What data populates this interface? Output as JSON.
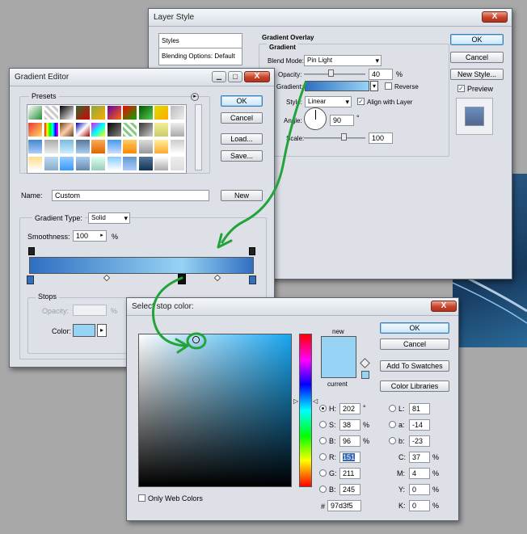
{
  "layer_style": {
    "title": "Layer Style",
    "sidebar": [
      "Styles",
      "Blending Options: Default"
    ],
    "section_title": "Gradient Overlay",
    "group_title": "Gradient",
    "blend_mode_label": "Blend Mode:",
    "blend_mode": "Pin Light",
    "opacity_label": "Opacity:",
    "opacity": "40",
    "opacity_unit": "%",
    "gradient_label": "Gradient:",
    "reverse_label": "Reverse",
    "style_label": "Style:",
    "style": "Linear",
    "align_label": "Align with Layer",
    "angle_label": "Angle:",
    "angle": "90",
    "angle_unit": "°",
    "scale_label": "Scale:",
    "scale": "100",
    "ok": "OK",
    "cancel": "Cancel",
    "new_style": "New Style...",
    "preview_label": "Preview",
    "close_glyph": "X"
  },
  "gradient_editor": {
    "title": "Gradient Editor",
    "presets_label": "Presets",
    "ok": "OK",
    "cancel": "Cancel",
    "load": "Load...",
    "save": "Save...",
    "name_label": "Name:",
    "name_value": "Custom",
    "new": "New",
    "gradient_type_label": "Gradient Type:",
    "gradient_type": "Solid",
    "smoothness_label": "Smoothness:",
    "smoothness": "100",
    "smoothness_unit": "%",
    "stops_label": "Stops",
    "opacity_label": "Opacity:",
    "opacity_unit": "%",
    "color_label": "Color:",
    "close_glyph": "X",
    "gradient_from": "#2f6fc0",
    "gradient_to": "#97d3f5"
  },
  "color_picker": {
    "title": "Select stop color:",
    "ok": "OK",
    "cancel": "Cancel",
    "add_swatches": "Add To Swatches",
    "color_libraries": "Color Libraries",
    "new_label": "new",
    "current_label": "current",
    "only_web": "Only Web Colors",
    "close_glyph": "X",
    "current_color": "#97d3f5",
    "hsb": [
      {
        "label": "H:",
        "value": "202",
        "unit": "°"
      },
      {
        "label": "S:",
        "value": "38",
        "unit": "%"
      },
      {
        "label": "B:",
        "value": "96",
        "unit": "%"
      }
    ],
    "rgb": [
      {
        "label": "R:",
        "value": "151"
      },
      {
        "label": "G:",
        "value": "211"
      },
      {
        "label": "B:",
        "value": "245"
      }
    ],
    "lab": [
      {
        "label": "L:",
        "value": "81"
      },
      {
        "label": "a:",
        "value": "-14"
      },
      {
        "label": "b:",
        "value": "-23"
      }
    ],
    "cmyk": [
      {
        "label": "C:",
        "value": "37",
        "unit": "%"
      },
      {
        "label": "M:",
        "value": "4",
        "unit": "%"
      },
      {
        "label": "Y:",
        "value": "0",
        "unit": "%"
      },
      {
        "label": "K:",
        "value": "0",
        "unit": "%"
      }
    ],
    "hex_label": "#",
    "hex": "97d3f5"
  },
  "colors": {
    "annotation_green": "#22a43a",
    "field_hue": "#1aa6f0"
  }
}
